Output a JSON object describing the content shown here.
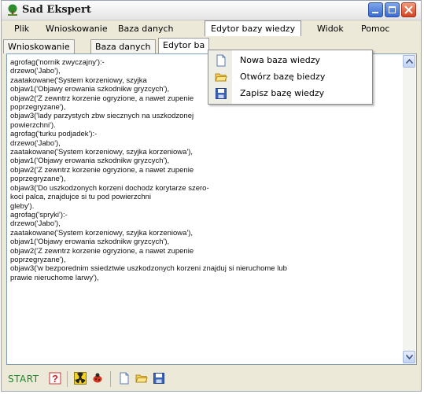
{
  "window": {
    "title": "Sad Ekspert"
  },
  "menu": [
    "Plik",
    "Wnioskowanie",
    "Baza danych",
    "Edytor bazy wiedzy",
    "Widok",
    "Pomoc"
  ],
  "tabs": [
    "Wnioskowanie",
    "Baza danych",
    "Edytor ba"
  ],
  "dropdown": [
    {
      "label": "Nowa baza wiedzy",
      "icon": "new-file-icon"
    },
    {
      "label": "Otwórz bazę biedzy",
      "icon": "open-folder-icon"
    },
    {
      "label": "Zapisz bazę wiedzy",
      "icon": "save-disk-icon"
    }
  ],
  "editor_lines": [
    "agrofag('nornik zwyczajny'):-",
    "drzewo('Jabo'),",
    "zaatakowane('System korzeniowy, szyjka",
    "objaw1('Objawy erowania szkodnikw gryzcych'),",
    "objaw2('Z zewntrz korzenie ogryzione, a nawet zupenie",
    "poprzegryzane'),",
    "objaw3('lady parzystych zbw siecznych na uszkodzonej",
    "powierzchni').",
    "",
    "agrofag('turku podjadek'):-",
    "drzewo('Jabo'),",
    "zaatakowane('System korzeniowy, szyjka korzeniowa'),",
    "objaw1('Objawy erowania szkodnikw gryzcych'),",
    "objaw2('Z zewntrz korzenie ogryzione, a nawet zupenie",
    "poprzegryzane'),",
    "objaw3('Do uszkodzonych korzeni dochodz korytarze szero-",
    "koci palca, znajdujce si tu pod powierzchni",
    "gleby').",
    "",
    "",
    "agrofag('spryki'):-",
    "drzewo('Jabo'),",
    "zaatakowane('System korzeniowy, szyjka korzeniowa'),",
    "objaw1('Objawy erowania szkodnikw gryzcych'),",
    "objaw2('Z zewntrz korzenie ogryzione, a nawet zupenie",
    "poprzegryzane'),",
    "objaw3('w bezporednim ssiedztwie uszkodzonych korzeni znajduj si nieruchome lub",
    "prawie nieruchome larwy'),"
  ],
  "status": {
    "start_label": "START"
  },
  "toolbar_icons": [
    "help-icon",
    "radiation-icon",
    "bug-icon",
    "new-file-icon",
    "open-folder-icon",
    "save-disk-icon"
  ]
}
